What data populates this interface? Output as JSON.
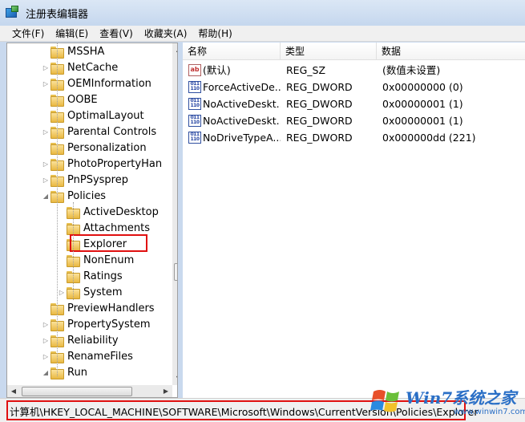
{
  "window": {
    "title": "注册表编辑器"
  },
  "menu": [
    "文件(F)",
    "编辑(E)",
    "查看(V)",
    "收藏夹(A)",
    "帮助(H)"
  ],
  "tree": {
    "items": [
      {
        "label": "MSSHA",
        "level": 1,
        "expandable": false,
        "expanded": false,
        "selected": false
      },
      {
        "label": "NetCache",
        "level": 1,
        "expandable": true,
        "expanded": false,
        "selected": false
      },
      {
        "label": "OEMInformation",
        "level": 1,
        "expandable": true,
        "expanded": false,
        "selected": false
      },
      {
        "label": "OOBE",
        "level": 1,
        "expandable": false,
        "expanded": false,
        "selected": false
      },
      {
        "label": "OptimalLayout",
        "level": 1,
        "expandable": false,
        "expanded": false,
        "selected": false
      },
      {
        "label": "Parental Controls",
        "level": 1,
        "expandable": true,
        "expanded": false,
        "selected": false
      },
      {
        "label": "Personalization",
        "level": 1,
        "expandable": false,
        "expanded": false,
        "selected": false
      },
      {
        "label": "PhotoPropertyHan",
        "level": 1,
        "expandable": true,
        "expanded": false,
        "selected": false
      },
      {
        "label": "PnPSysprep",
        "level": 1,
        "expandable": true,
        "expanded": false,
        "selected": false
      },
      {
        "label": "Policies",
        "level": 1,
        "expandable": true,
        "expanded": true,
        "selected": false
      },
      {
        "label": "ActiveDesktop",
        "level": 2,
        "expandable": false,
        "expanded": false,
        "selected": false
      },
      {
        "label": "Attachments",
        "level": 2,
        "expandable": false,
        "expanded": false,
        "selected": false
      },
      {
        "label": "Explorer",
        "level": 2,
        "expandable": false,
        "expanded": false,
        "selected": true
      },
      {
        "label": "NonEnum",
        "level": 2,
        "expandable": false,
        "expanded": false,
        "selected": false
      },
      {
        "label": "Ratings",
        "level": 2,
        "expandable": false,
        "expanded": false,
        "selected": false
      },
      {
        "label": "System",
        "level": 2,
        "expandable": true,
        "expanded": false,
        "selected": false
      },
      {
        "label": "PreviewHandlers",
        "level": 1,
        "expandable": false,
        "expanded": false,
        "selected": false
      },
      {
        "label": "PropertySystem",
        "level": 1,
        "expandable": true,
        "expanded": false,
        "selected": false
      },
      {
        "label": "Reliability",
        "level": 1,
        "expandable": true,
        "expanded": false,
        "selected": false
      },
      {
        "label": "RenameFiles",
        "level": 1,
        "expandable": true,
        "expanded": false,
        "selected": false
      },
      {
        "label": "Run",
        "level": 1,
        "expandable": true,
        "expanded": true,
        "selected": false
      }
    ]
  },
  "list": {
    "columns": [
      "名称",
      "类型",
      "数据"
    ],
    "rows": [
      {
        "icon": "string-value-icon",
        "name": "(默认)",
        "type": "REG_SZ",
        "data": "(数值未设置)"
      },
      {
        "icon": "binary-value-icon",
        "name": "ForceActiveDe...",
        "type": "REG_DWORD",
        "data": "0x00000000 (0)"
      },
      {
        "icon": "binary-value-icon",
        "name": "NoActiveDeskt...",
        "type": "REG_DWORD",
        "data": "0x00000001 (1)"
      },
      {
        "icon": "binary-value-icon",
        "name": "NoActiveDeskt...",
        "type": "REG_DWORD",
        "data": "0x00000001 (1)"
      },
      {
        "icon": "binary-value-icon",
        "name": "NoDriveTypeA...",
        "type": "REG_DWORD",
        "data": "0x000000dd (221)"
      }
    ]
  },
  "status": {
    "path": "计算机\\HKEY_LOCAL_MACHINE\\SOFTWARE\\Microsoft\\Windows\\CurrentVersion\\Policies\\Explorer"
  },
  "watermark": {
    "brand": "Win7系统之家",
    "url": "www.winwin7.com"
  },
  "colors": {
    "highlight": "#e01010",
    "folder": "#e9b842",
    "window_frame": "#c9d9ee"
  }
}
